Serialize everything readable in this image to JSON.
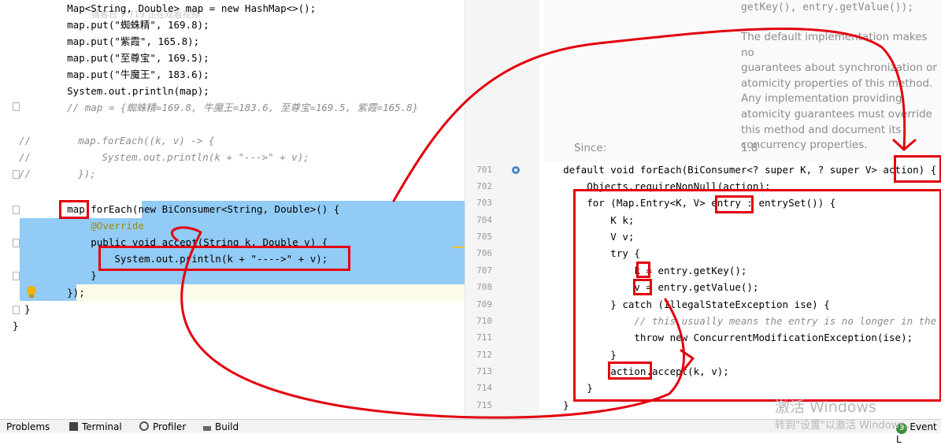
{
  "left_code": {
    "watermark": "播客日 7.719 正在观看视频",
    "lines": [
      {
        "t": "      Map<String, Double> map = new HashMap<>();"
      },
      {
        "t": "      map.put(\"蜘蛛精\", 169.8);"
      },
      {
        "t": "      map.put(\"紫霞\", 165.8);"
      },
      {
        "t": "      map.put(\"至尊宝\", 169.5);"
      },
      {
        "t": "      map.put(\"牛魔王\", 183.6);"
      },
      {
        "t": "      System.out.println(map);"
      },
      {
        "t": "      // map = {蜘蛛精=169.8, 牛魔王=183.6, 至尊宝=169.5, 紫霞=165.8}"
      },
      {
        "t": ""
      },
      {
        "t": "//        map.forEach((k, v) -> {"
      },
      {
        "t": "//            System.out.println(k + \"--->\" + v);"
      },
      {
        "t": "//        });"
      },
      {
        "t": ""
      },
      {
        "t": "      map.forEach(new BiConsumer<String, Double>() {"
      },
      {
        "t": "          @Override"
      },
      {
        "t": "          public void accept(String k, Double v) {"
      },
      {
        "t": "              System.out.println(k + \"---->\" + v);"
      },
      {
        "t": "          }"
      },
      {
        "t": "      });"
      },
      {
        "t": "  }"
      },
      {
        "t": "}"
      }
    ]
  },
  "doc_popup": {
    "top_text": "getKey(), entry.getValue());",
    "paragraph": [
      "The default implementation makes no",
      "guarantees about synchronization or",
      "atomicity properties of this method.",
      "Any implementation providing",
      "atomicity guarantees must override",
      "this method and document its",
      "concurrency properties."
    ],
    "since_label": "Since:",
    "since_value": "1.8"
  },
  "right_code": {
    "lines": [
      {
        "n": "701",
        "t": "    default void forEach(BiConsumer<? super K, ? super V> action) {"
      },
      {
        "n": "702",
        "t": "        Objects.requireNonNull(action);"
      },
      {
        "n": "703",
        "t": "        for (Map.Entry<K, V> entry : entrySet()) {"
      },
      {
        "n": "704",
        "t": "            K k;"
      },
      {
        "n": "705",
        "t": "            V v;"
      },
      {
        "n": "706",
        "t": "            try {"
      },
      {
        "n": "707",
        "t": "                k = entry.getKey();"
      },
      {
        "n": "708",
        "t": "                v = entry.getValue();"
      },
      {
        "n": "709",
        "t": "            } catch (IllegalStateException ise) {"
      },
      {
        "n": "710",
        "t": "                // this usually means the entry is no longer in the map."
      },
      {
        "n": "711",
        "t": "                throw new ConcurrentModificationException(ise);"
      },
      {
        "n": "712",
        "t": "            }"
      },
      {
        "n": "713",
        "t": "            action.accept(k, v);"
      },
      {
        "n": "714",
        "t": "        }"
      },
      {
        "n": "715",
        "t": "    }"
      }
    ]
  },
  "bottom_toolbar": {
    "problems": "Problems",
    "terminal": "Terminal",
    "profiler": "Profiler",
    "build": "Build",
    "event_log": "Event L",
    "event_count": "3"
  },
  "windows_watermark": {
    "line1": "激活 Windows",
    "line2": "转到\"设置\"以激活 Windows。"
  },
  "colors": {
    "annotation_red": "#e3000f",
    "selection_blue": "#8cc8f5"
  }
}
